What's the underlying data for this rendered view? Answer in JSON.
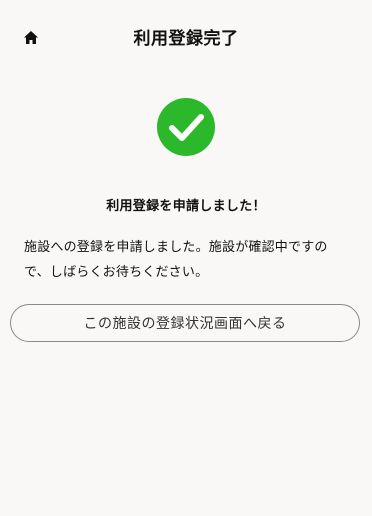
{
  "header": {
    "title": "利用登録完了",
    "home_icon": "home-icon"
  },
  "status": {
    "icon": "check-circle-icon",
    "icon_color": "#2bb82b",
    "headline": "利用登録を申請しました！"
  },
  "message": {
    "line1": "施設への登録を申請しました。施設が確認中ですの",
    "line2": "で、しばらくお待ちください。"
  },
  "actions": {
    "back_label": "この施設の登録状況画面へ戻る"
  }
}
